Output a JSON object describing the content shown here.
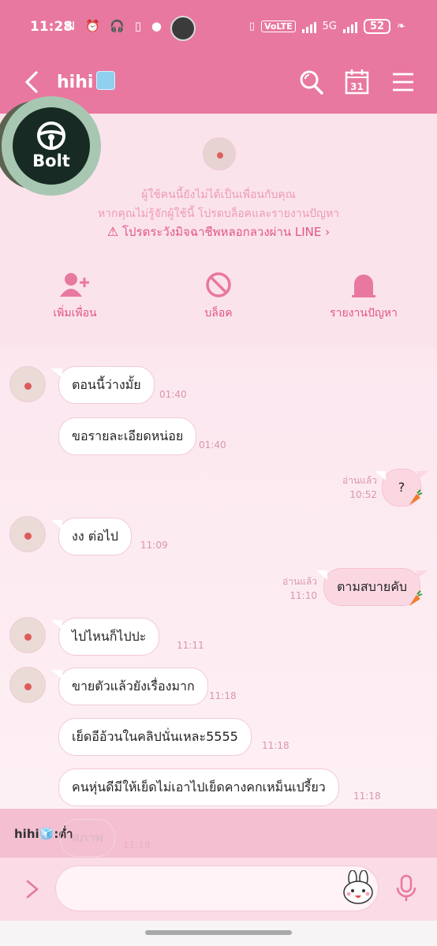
{
  "status_bar": {
    "time": "11:28",
    "battery": "52",
    "network": "5G",
    "volte": "VoLTE"
  },
  "header": {
    "title": "hihi"
  },
  "profile": {
    "notice_line1": "ผู้ใช้คนนี้ยังไม่ได้เป็นเพื่อนกับคุณ",
    "notice_line2": "หากคุณไม่รู้จักผู้ใช้นี้ โปรดบล็อคและรายงานปัญหา",
    "warning_link": "โปรดระวังมิจฉาชีพหลอกลวงผ่าน LINE",
    "actions": [
      {
        "label": "เพิ่มเพื่อน",
        "icon": "add-friend-icon"
      },
      {
        "label": "บล็อค",
        "icon": "block-icon"
      },
      {
        "label": "รายงานปัญหา",
        "icon": "report-icon"
      }
    ]
  },
  "bolt_bubble": {
    "label": "Bolt"
  },
  "messages": [
    {
      "side": "in",
      "text": "ตอนนี้ว่างมั้ย",
      "time": "01:40"
    },
    {
      "side": "in",
      "text": "ขอรายละเอียดหน่อย",
      "time": "01:40"
    },
    {
      "side": "out",
      "text": "?",
      "time": "10:52",
      "read": "อ่านแล้ว"
    },
    {
      "side": "in",
      "text": "งง ต่อไป",
      "time": "11:09"
    },
    {
      "side": "out",
      "text": "ตามสบายคับ",
      "time": "11:10",
      "read": "อ่านแล้ว"
    },
    {
      "side": "in",
      "text": "ไปไหนก็ไปปะ",
      "time": "11:11"
    },
    {
      "side": "in",
      "text": "ขายตัวแล้วยังเรื่องมาก",
      "time": "11:18"
    },
    {
      "side": "in",
      "text": "เย็ดอีอ้วนในคลิปนั่นเหละ5555",
      "time": "11:18"
    },
    {
      "side": "in",
      "text": "คนหุ่นดีมีให้เย็ดไม่เอาไปเย็ดคางคกเหม็นเปรี้ยว",
      "time": "11:18"
    }
  ],
  "reply_preview": {
    "text": "hihi🧊:ต่ำ",
    "faded_message": "สภาพ",
    "faded_time": "11:18"
  },
  "input": {
    "placeholder": ""
  },
  "colors": {
    "header": "#e8789f",
    "accent": "#e25584",
    "background": "#fbe3ec"
  }
}
